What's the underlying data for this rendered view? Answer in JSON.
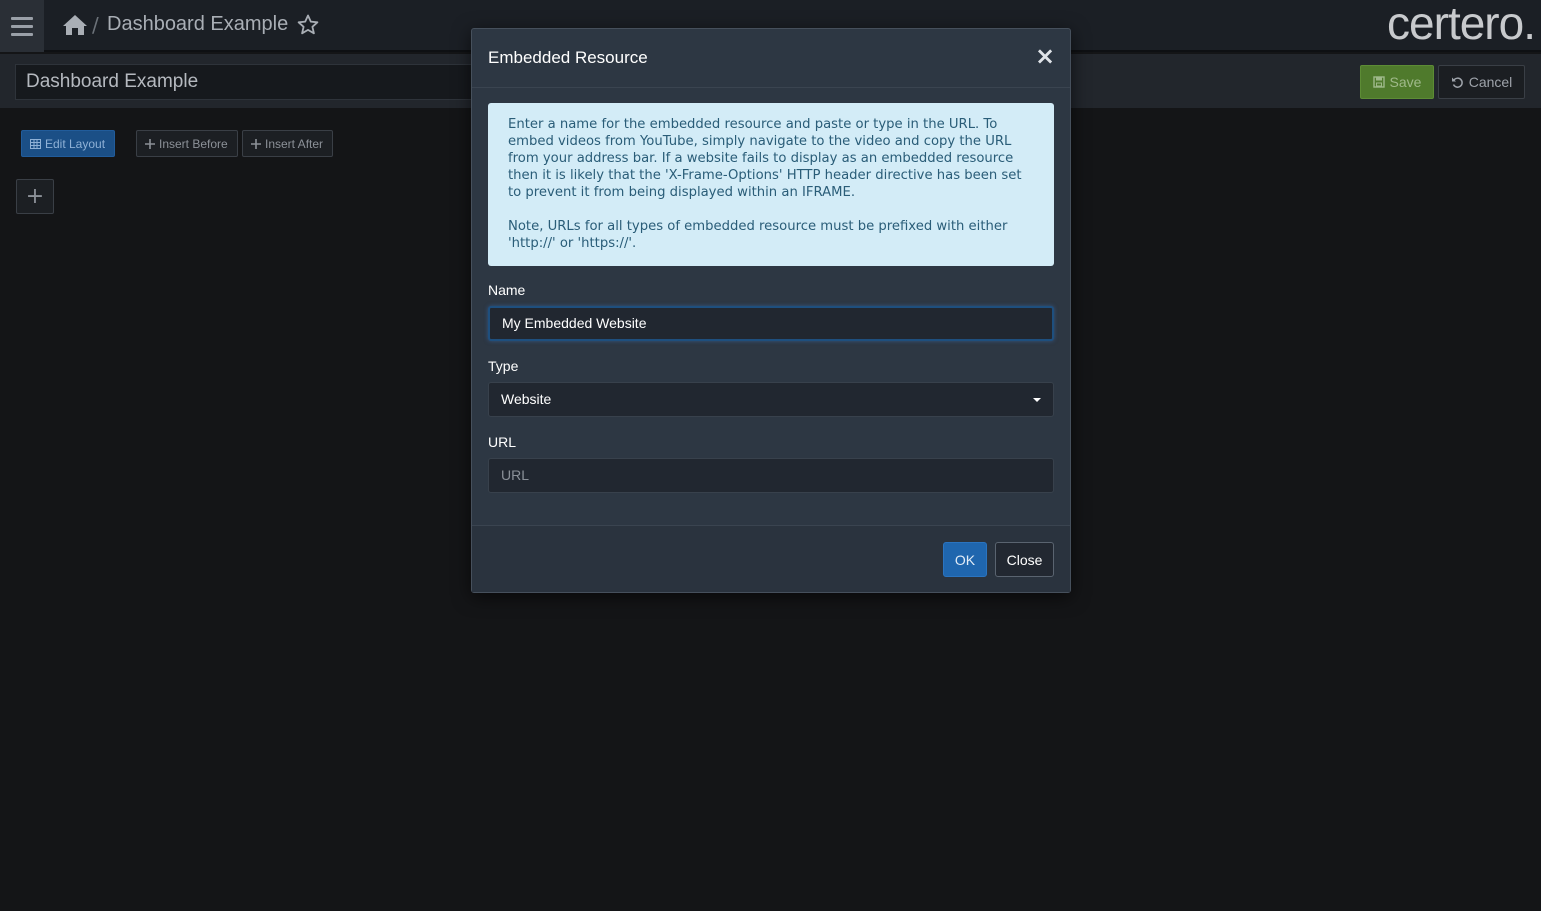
{
  "header": {
    "breadcrumb_separator": "/",
    "page_title": "Dashboard Example",
    "brand": "certero."
  },
  "subbar": {
    "dashboard_name": "Dashboard Example",
    "save_label": "Save",
    "cancel_label": "Cancel"
  },
  "toolbar": {
    "edit_layout_label": "Edit Layout",
    "insert_before_label": "Insert Before",
    "insert_after_label": "Insert After",
    "add_tile_label": "+"
  },
  "modal": {
    "title": "Embedded Resource",
    "close_symbol": "×",
    "info_paragraph_1": "Enter a name for the embedded resource and paste or type in the URL. To embed videos from YouTube, simply navigate to the video and copy the URL from your address bar. If a website fails to display as an embedded resource then it is likely that the 'X-Frame-Options' HTTP header directive has been set to prevent it from being displayed within an IFRAME.",
    "info_paragraph_2": "Note, URLs for all types of embedded resource must be prefixed with either 'http://' or 'https://'.",
    "name_label": "Name",
    "name_value": "My Embedded Website",
    "type_label": "Type",
    "type_value": "Website",
    "url_label": "URL",
    "url_placeholder": "URL",
    "ok_label": "OK",
    "close_label": "Close"
  },
  "colors": {
    "accent_blue": "#1f66ae",
    "save_green": "#4f7a2c",
    "info_bg": "#d3ecf7",
    "modal_bg": "#2d3743"
  },
  "icons": [
    "menu-icon",
    "home-icon",
    "star-icon",
    "save-icon",
    "undo-icon",
    "grid-icon",
    "plus-icon",
    "close-icon",
    "caret-down-icon"
  ]
}
